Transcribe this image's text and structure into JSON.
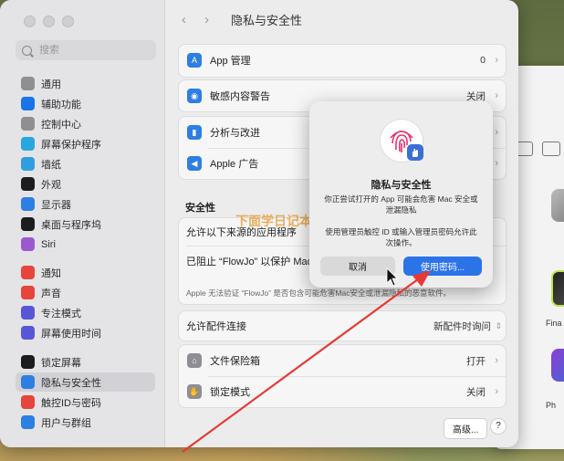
{
  "window": {
    "title": "隐私与安全性"
  },
  "search": {
    "placeholder": "搜索"
  },
  "sidebar": {
    "items": [
      {
        "label": "通用",
        "icon": "gear-icon",
        "color": "#8e8e93"
      },
      {
        "label": "辅助功能",
        "icon": "accessibility-icon",
        "color": "#1a73e8"
      },
      {
        "label": "控制中心",
        "icon": "control-center-icon",
        "color": "#8e8e93"
      },
      {
        "label": "屏幕保护程序",
        "icon": "screensaver-icon",
        "color": "#29a6e0"
      },
      {
        "label": "墙纸",
        "icon": "wallpaper-icon",
        "color": "#2f9ddf"
      },
      {
        "label": "外观",
        "icon": "appearance-icon",
        "color": "#1c1c1e"
      },
      {
        "label": "显示器",
        "icon": "display-icon",
        "color": "#2d7fe3"
      },
      {
        "label": "桌面与程序坞",
        "icon": "dock-icon",
        "color": "#1c1c1e"
      },
      {
        "label": "Siri",
        "icon": "siri-icon",
        "color": "#9b59d0"
      },
      {
        "label": "通知",
        "icon": "notification-icon",
        "color": "#e5453a"
      },
      {
        "label": "声音",
        "icon": "sound-icon",
        "color": "#e5453a"
      },
      {
        "label": "专注模式",
        "icon": "focus-icon",
        "color": "#5856d6"
      },
      {
        "label": "屏幕使用时间",
        "icon": "screentime-icon",
        "color": "#5856d6"
      },
      {
        "label": "锁定屏幕",
        "icon": "lockscreen-icon",
        "color": "#1c1c1e"
      },
      {
        "label": "隐私与安全性",
        "icon": "privacy-hand-icon",
        "color": "#2d7fe3"
      },
      {
        "label": "触控ID与密码",
        "icon": "fingerprint-icon",
        "color": "#e5453a"
      },
      {
        "label": "用户与群组",
        "icon": "users-icon",
        "color": "#2d7fe3"
      }
    ]
  },
  "card1": {
    "app_mgmt_label": "App 管理",
    "app_mgmt_value": "0",
    "sensitive_label": "敏感内容警告",
    "sensitive_value": "关闭"
  },
  "card2": {
    "analytics_label": "分析与改进",
    "ads_label": "Apple 广告"
  },
  "security": {
    "title": "安全性",
    "allow_label": "允许以下来源的应用程序",
    "blocked_label": "已阻止 “FlowJo” 以保护 Mac。",
    "note": "Apple 无法验证 “FlowJo” 是否包含可能危害Mac安全或泄漏隐私的恶意软件。"
  },
  "accessory": {
    "label": "允许配件连接",
    "value": "新配件时询问"
  },
  "filevault": {
    "label": "文件保险箱",
    "value": "打开"
  },
  "lockdown": {
    "label": "锁定模式",
    "value": "关闭"
  },
  "buttons": {
    "advanced": "高级...",
    "help": "?"
  },
  "dialog": {
    "title": "隐私与安全性",
    "message1": "你正尝试打开的 App 可能会危害 Mac 安全或泄漏隐私",
    "message2": "使用管理员触控 ID 或输入管理员密码允许此次操作。",
    "cancel": "取消",
    "ok": "使用密码..."
  },
  "back_window": {
    "items": [
      "Fina",
      "Ph"
    ]
  },
  "watermark": {
    "title": "下面学日记本"
  },
  "colors": {
    "accent": "#2b73e8",
    "arrow": "#e53935"
  }
}
